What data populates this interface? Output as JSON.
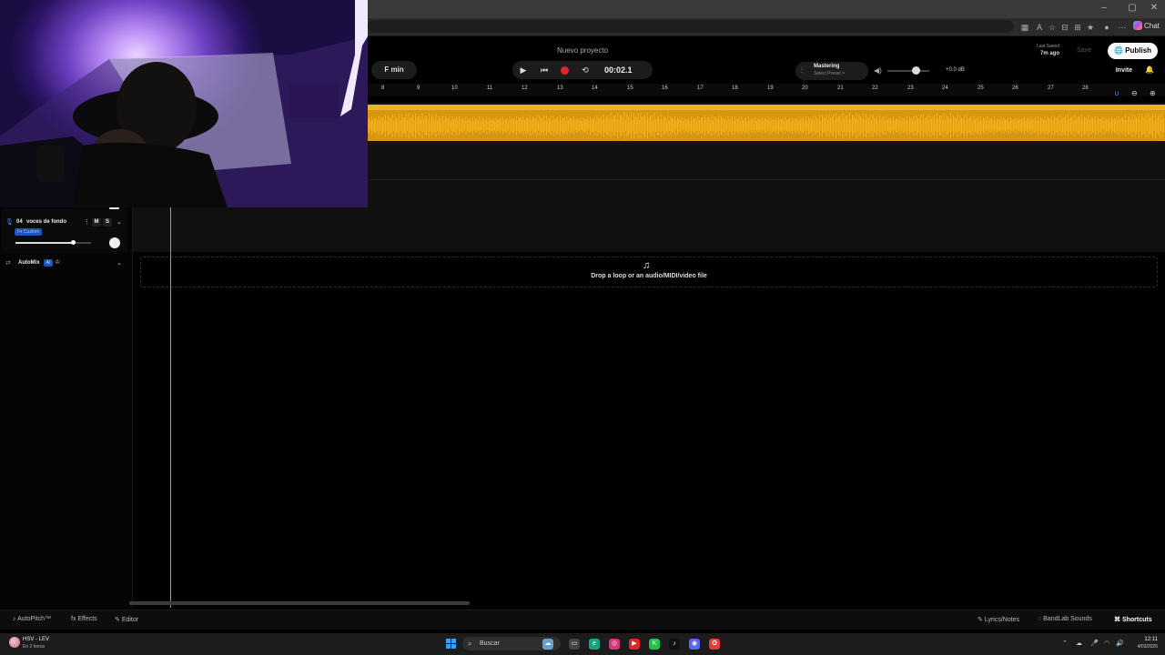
{
  "browser": {
    "chat_label": "Chat",
    "window_controls": [
      "–",
      "▢",
      "✕"
    ]
  },
  "header": {
    "project_title": "Nuevo proyecto",
    "key": "F min",
    "time": "00:02.1",
    "mastering_label": "Mastering",
    "mastering_sub": "Select Preset >",
    "volume_db": "+0.0 dB",
    "last_saved_label": "Last Saved",
    "last_saved_time": "7m ago",
    "save_label": "Save",
    "publish_label": "Publish",
    "invite_label": "Invite"
  },
  "ruler": {
    "bars": [
      "8",
      "9",
      "10",
      "11",
      "12",
      "13",
      "14",
      "15",
      "16",
      "17",
      "18",
      "19",
      "20",
      "21",
      "22",
      "23",
      "24",
      "25",
      "26",
      "27",
      "28"
    ]
  },
  "track": {
    "number": "04",
    "name": "voces de fondo",
    "mute": "M",
    "solo": "S",
    "fx_badge": "Fx Custom",
    "volume_level": 0.78
  },
  "automix": {
    "label": "AutoMix",
    "ai_badge": "AI"
  },
  "drop_zone": {
    "text": "Drop a loop or an audio/MIDI/video file"
  },
  "bottom_bar": {
    "autopitch": "AutoPitch™",
    "effects": "Effects",
    "editor": "Editor",
    "lyrics": "Lyrics/Notes",
    "sounds": "BandLab Sounds",
    "shortcuts": "Shortcuts"
  },
  "taskbar": {
    "weather_title": "HSV - LEV",
    "weather_sub": "En 2 horas",
    "search": "Buscar",
    "time": "12:11",
    "date": "4/03/2026"
  },
  "colors": {
    "region_fill": "#d69612",
    "region_header": "#f0b128",
    "waveform": "#f6b41a",
    "record": "#e0262d",
    "accent_blue": "#1a57b8"
  }
}
